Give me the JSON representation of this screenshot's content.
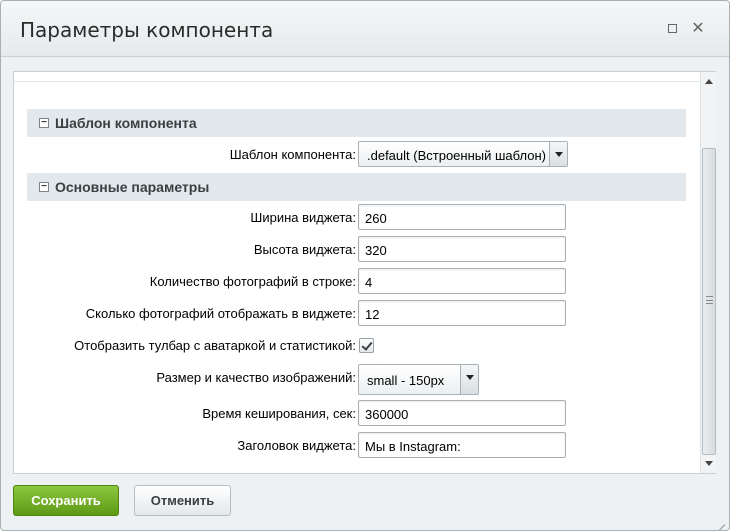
{
  "dialog": {
    "title": "Параметры компонента",
    "maximize_icon": "maximize-icon",
    "close_icon": "close-icon",
    "close_glyph": "✕"
  },
  "sections": {
    "template": {
      "title": "Шаблон компонента",
      "toggle_glyph": "−",
      "fields": {
        "template_label": "Шаблон компонента:",
        "template_value": ".default (Встроенный шаблон)"
      }
    },
    "main": {
      "title": "Основные параметры",
      "toggle_glyph": "−",
      "fields": {
        "width_label": "Ширина виджета:",
        "width_value": "260",
        "height_label": "Высота виджета:",
        "height_value": "320",
        "photos_row_label": "Количество фотографий в строке:",
        "photos_row_value": "4",
        "photos_total_label": "Сколько фотографий отображать в виджете:",
        "photos_total_value": "12",
        "toolbar_label": "Отобразить тулбар с аватаркой и статистикой:",
        "toolbar_checked": true,
        "image_size_label": "Размер и качество изображений:",
        "image_size_value": "small - 150px",
        "cache_label": "Время кеширования, сек:",
        "cache_value": "360000",
        "header_label": "Заголовок виджета:",
        "header_value": "Мы в Instagram:"
      }
    }
  },
  "footer": {
    "save_label": "Сохранить",
    "cancel_label": "Отменить"
  },
  "colors": {
    "save_button": "#6fae23",
    "section_header": "#e2e8eb",
    "dialog_background": "#eef1f3"
  }
}
